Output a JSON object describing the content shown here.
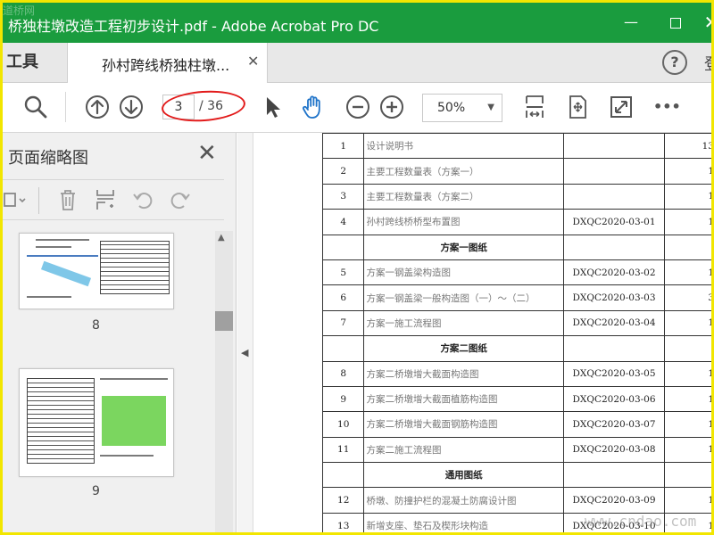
{
  "window": {
    "title": "桥独柱墩改造工程初步设计.pdf - Adobe Acrobat Pro DC",
    "watermark_tl": "道桥网"
  },
  "tabs": {
    "tools_label": "工具",
    "doc_label": "孙村跨线桥独柱墩...",
    "help_label": "?",
    "signin_label": "登"
  },
  "toolbar": {
    "page_current": "3",
    "page_total": "/ 36",
    "zoom": "50%",
    "more": "•••"
  },
  "thumbnails_panel": {
    "title": "页面缩略图",
    "pages": [
      {
        "label": "8"
      },
      {
        "label": "9"
      }
    ]
  },
  "document": {
    "rows": [
      {
        "no": "1",
        "name": "设计说明书",
        "code": "",
        "sheets": "13"
      },
      {
        "no": "2",
        "name": "主要工程数量表（方案一）",
        "code": "",
        "sheets": "1"
      },
      {
        "no": "3",
        "name": "主要工程数量表（方案二）",
        "code": "",
        "sheets": "1"
      },
      {
        "no": "4",
        "name": "孙村跨线桥桥型布置图",
        "code": "DXQC2020-03-01",
        "sheets": "1"
      },
      {
        "section": "方案一图纸"
      },
      {
        "no": "5",
        "name": "方案一钢盖梁构造图",
        "code": "DXQC2020-03-02",
        "sheets": "1"
      },
      {
        "no": "6",
        "name": "方案一钢盖梁一般构造图（一）～（二）",
        "code": "DXQC2020-03-03",
        "sheets": "3"
      },
      {
        "no": "7",
        "name": "方案一施工流程图",
        "code": "DXQC2020-03-04",
        "sheets": "1"
      },
      {
        "section": "方案二图纸"
      },
      {
        "no": "8",
        "name": "方案二桥墩增大截面构造图",
        "code": "DXQC2020-03-05",
        "sheets": "1"
      },
      {
        "no": "9",
        "name": "方案二桥墩增大截面植筋构造图",
        "code": "DXQC2020-03-06",
        "sheets": "1"
      },
      {
        "no": "10",
        "name": "方案二桥墩增大截面钢筋构造图",
        "code": "DXQC2020-03-07",
        "sheets": "1"
      },
      {
        "no": "11",
        "name": "方案二施工流程图",
        "code": "DXQC2020-03-08",
        "sheets": "1"
      },
      {
        "section": "通用图纸"
      },
      {
        "no": "12",
        "name": "桥墩、防撞护栏的混凝土防腐设计图",
        "code": "DXQC2020-03-09",
        "sheets": "1"
      },
      {
        "no": "13",
        "name": "新增支座、垫石及楔形块构造",
        "code": "DXQC2020-03-10",
        "sheets": "1"
      }
    ]
  },
  "watermark_br": "www.cndao.com",
  "colors": {
    "titlebar": "#1a9c3e",
    "highlight_circle": "#e21a1a",
    "frame_border": "#f2e600"
  }
}
